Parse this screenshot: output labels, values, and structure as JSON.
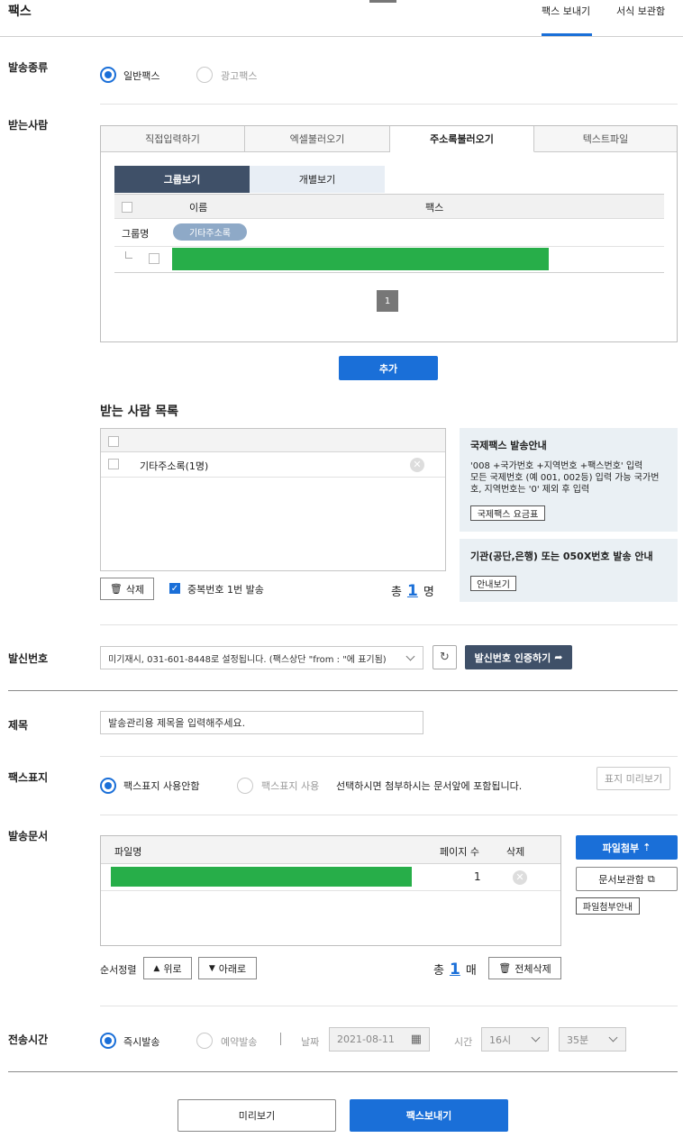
{
  "header": {
    "title": "팩스",
    "tabs": [
      {
        "label": "팩스 보내기",
        "active": true
      },
      {
        "label": "서식 보관함",
        "active": false
      }
    ]
  },
  "send_type": {
    "label": "발송종류",
    "options": [
      {
        "label": "일반팩스",
        "selected": true
      },
      {
        "label": "광고팩스",
        "selected": false
      }
    ]
  },
  "recipients": {
    "label": "받는사람",
    "tabs": [
      "직접입력하기",
      "엑셀불러오기",
      "주소록불러오기",
      "텍스트파일"
    ],
    "active_tab": 2,
    "view_tabs": [
      "그룹보기",
      "개별보기"
    ],
    "table_headers": {
      "name": "이름",
      "fax": "팩스"
    },
    "group_label": "그룹명",
    "group_badge": "기타주소록",
    "page": "1",
    "add_button": "추가"
  },
  "recipient_list": {
    "title": "받는 사람 목록",
    "items": [
      {
        "label": "기타주소록(1명)"
      }
    ],
    "delete_button": "삭제",
    "dedupe_label": "중복번호 1번 발송",
    "total_prefix": "총",
    "total_count": "1",
    "total_unit": "명"
  },
  "info_intl": {
    "title": "국제팩스 발송안내",
    "lines": [
      "'008 +국가번호 +지역번호 +팩스번호' 입력",
      "모든 국제번호 (예 001, 002등) 입력 가능 국가번",
      "호, 지역번호는 '0' 제외 후 입력"
    ],
    "button": "국제팩스 요금표"
  },
  "info_org": {
    "title": "기관(공단,은행) 또는 050X번호 발송 안내",
    "button": "안내보기"
  },
  "sender": {
    "label": "발신번호",
    "value": "미기재시, 031-601-8448로 설정됩니다. (팩스상단 \"from : \"에 표기됨)",
    "verify_button": "발신번호 인증하기"
  },
  "subject": {
    "label": "제목",
    "placeholder": "발송관리용 제목을 입력해주세요."
  },
  "cover": {
    "label": "팩스표지",
    "options": [
      {
        "label": "팩스표지 사용안함",
        "selected": true
      },
      {
        "label": "팩스표지 사용",
        "selected": false
      }
    ],
    "note": "선택하시면 첨부하시는 문서앞에 포함됩니다.",
    "preview_button": "표지 미리보기"
  },
  "documents": {
    "label": "발송문서",
    "headers": {
      "name": "파일명",
      "pages": "페이지 수",
      "delete": "삭제"
    },
    "files": [
      {
        "pages": "1"
      }
    ],
    "attach_button": "파일첨부",
    "storage_button": "문서보관함",
    "guide_button": "파일첨부안내",
    "sort_label": "순서정렬",
    "up_button": "위로",
    "down_button": "아래로",
    "total_prefix": "총",
    "total_count": "1",
    "total_unit": "매",
    "delete_all_button": "전체삭제"
  },
  "send_time": {
    "label": "전송시간",
    "options": [
      {
        "label": "즉시발송",
        "selected": true
      },
      {
        "label": "예약발송",
        "selected": false
      }
    ],
    "date_label": "날짜",
    "date_value": "2021-08-11",
    "time_label": "시간",
    "hour_value": "16시",
    "minute_value": "35분"
  },
  "footer": {
    "preview_button": "미리보기",
    "send_button": "팩스보내기"
  },
  "colors": {
    "accent": "#1a6fd8",
    "navy": "#3f5068",
    "redaction": "#27ae49",
    "info_bg": "#eaf0f4"
  }
}
